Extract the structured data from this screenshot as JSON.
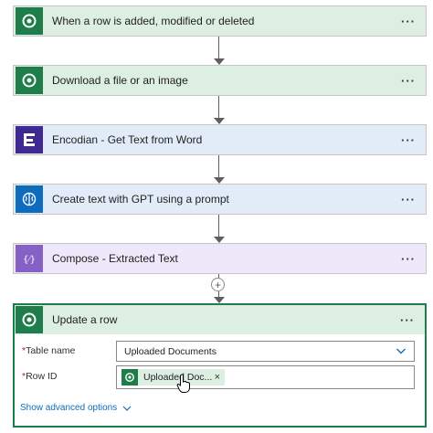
{
  "flow_steps": [
    {
      "title": "When a row is added, modified or deleted",
      "icon": "dataverse-icon",
      "color": "#1f7d4c"
    },
    {
      "title": "Download a file or an image",
      "icon": "dataverse-icon",
      "color": "#1f7d4c"
    },
    {
      "title": "Encodian - Get Text from Word",
      "icon": "encodian-icon",
      "color": "#3f2a91"
    },
    {
      "title": "Create text with GPT using a prompt",
      "icon": "ai-brain-icon",
      "color": "#0f6cbd"
    },
    {
      "title": "Compose - Extracted Text",
      "icon": "compose-icon",
      "color": "#8661c5"
    }
  ],
  "more_glyph": "···",
  "add_glyph": "+",
  "expanded_step": {
    "title": "Update a row",
    "icon": "dataverse-icon",
    "fields": {
      "table_name": {
        "required_mark": "*",
        "label": "Table name",
        "value": "Uploaded Documents"
      },
      "row_id": {
        "required_mark": "*",
        "label": "Row ID",
        "token": "Uploaded Doc...",
        "token_remove": "×"
      }
    },
    "advanced_link": "Show advanced options"
  }
}
